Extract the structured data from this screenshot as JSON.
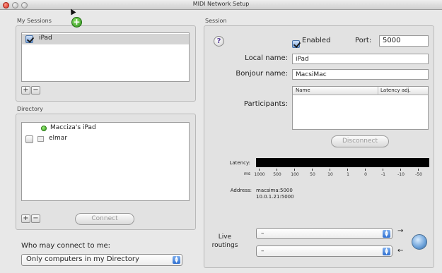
{
  "window": {
    "title": "MIDI Network Setup"
  },
  "my_sessions": {
    "label": "My Sessions",
    "items": [
      {
        "name": "iPad",
        "checked": true
      }
    ],
    "add_label": "+",
    "remove_label": "−"
  },
  "directory": {
    "label": "Directory",
    "items": [
      {
        "name": "Macciza's iPad",
        "connected": true
      },
      {
        "name": "elmar",
        "connected": false
      }
    ],
    "add_label": "+",
    "remove_label": "−",
    "connect_label": "Connect"
  },
  "who_may_connect": {
    "label": "Who may connect to me:",
    "selected": "Only computers in my Directory"
  },
  "session": {
    "label": "Session",
    "help_label": "?",
    "enabled_label": "Enabled",
    "enabled": true,
    "port_label": "Port:",
    "port_value": "5000",
    "local_name_label": "Local name:",
    "local_name_value": "iPad",
    "bonjour_name_label": "Bonjour name:",
    "bonjour_name_value": "MacsiMac",
    "participants_label": "Participants:",
    "participants_columns": [
      "Name",
      "Latency adj."
    ],
    "disconnect_label": "Disconnect",
    "latency_label": "Latency:",
    "ms_label": "ms",
    "latency_ticks": [
      "1000",
      "500",
      "100",
      "50",
      "10",
      "1",
      "0",
      "-1",
      "-10",
      "-50"
    ],
    "address_label": "Address:",
    "address_line1": "macsima:5000",
    "address_line2": "10.0.1.21:5000"
  },
  "live_routings": {
    "label_line1": "Live",
    "label_line2": "routings",
    "in_value": "–",
    "out_value": "–"
  }
}
